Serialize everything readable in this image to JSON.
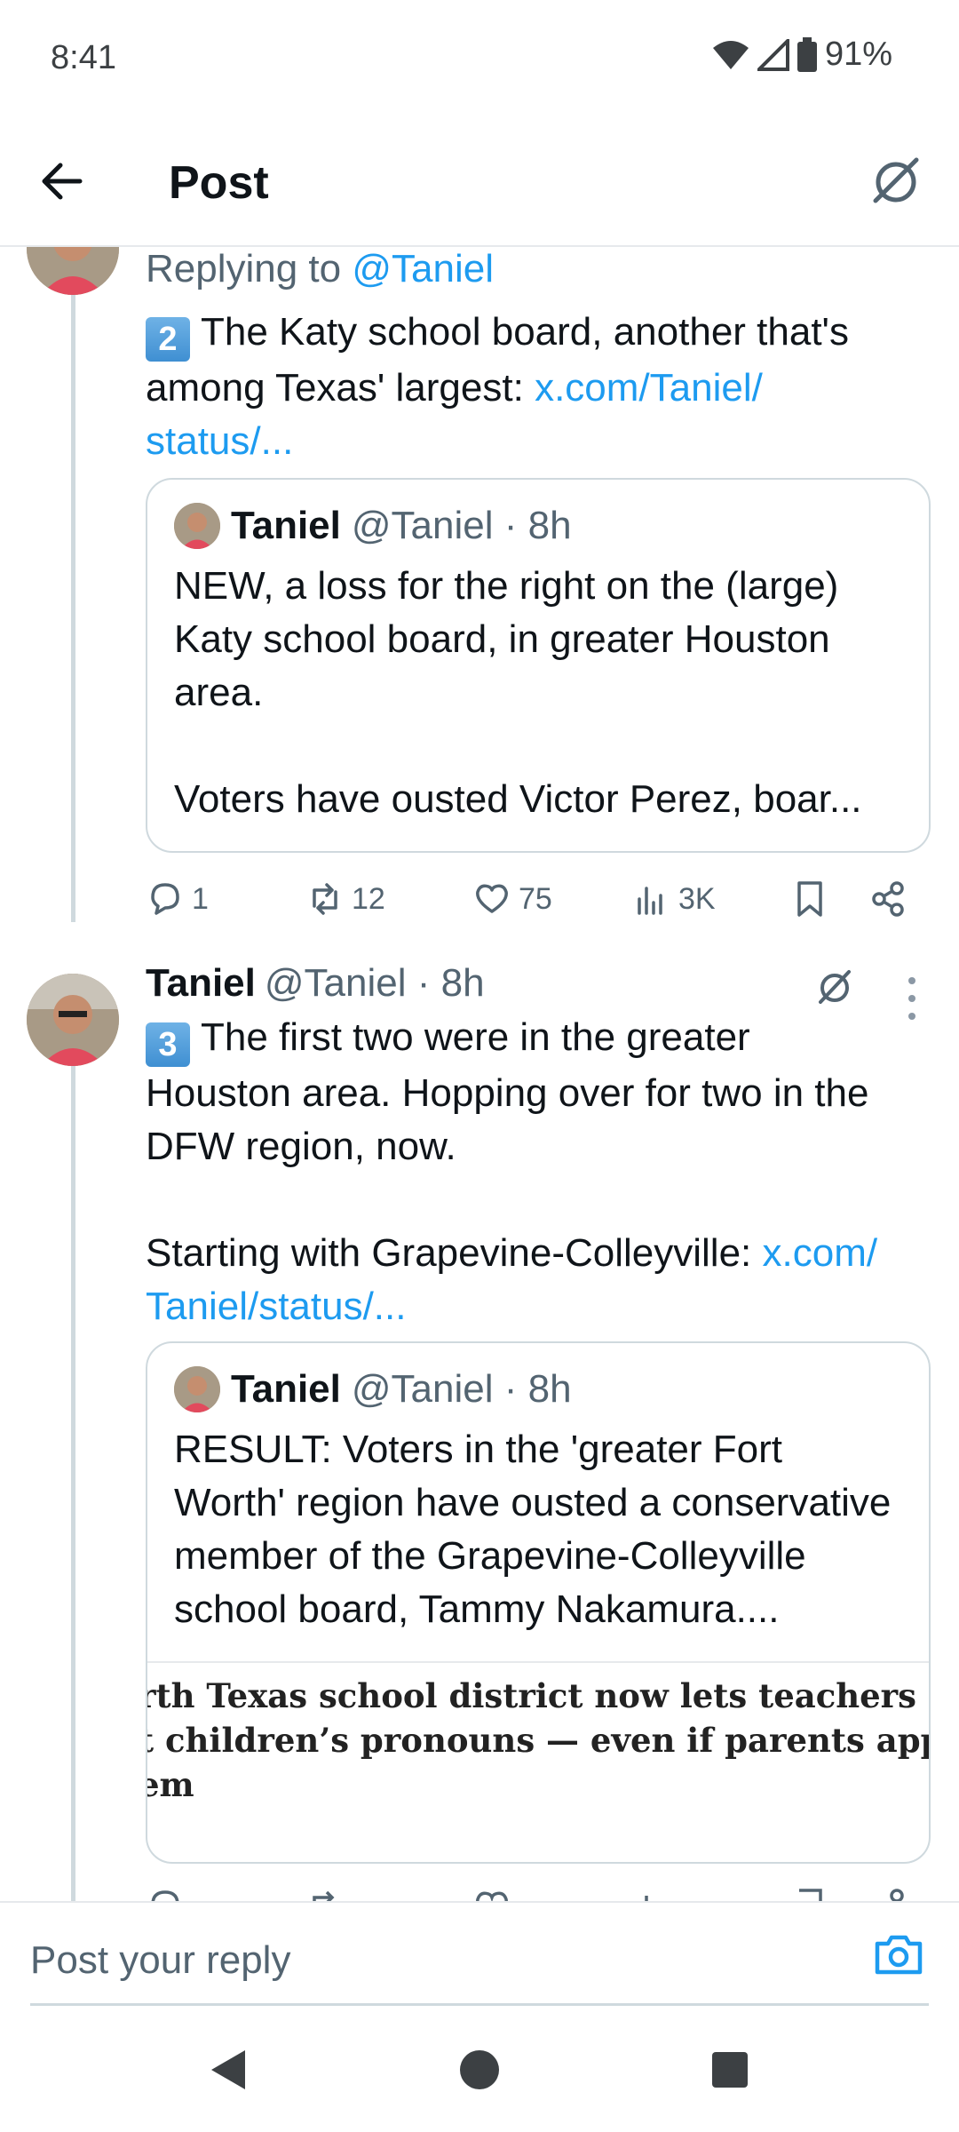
{
  "status_bar": {
    "time": "8:41",
    "battery": "91%"
  },
  "header": {
    "title": "Post"
  },
  "thread": {
    "replying_prefix": "Replying to",
    "replying_handle": "@Taniel",
    "post2": {
      "keycap": "2",
      "text": "The Katy school board, another that's among Texas' largest:",
      "link_line1": "x.com/Taniel/",
      "link_line2": "status/...",
      "quote": {
        "name": "Taniel",
        "handle_time": "@Taniel · 8h",
        "text": "NEW, a loss for the right on the (large) Katy school board, in greater Houston area.\n\nVoters have ousted Victor Perez, boar..."
      },
      "stats": {
        "replies": "1",
        "reposts": "12",
        "likes": "75",
        "views": "3K"
      }
    },
    "post3": {
      "name": "Taniel",
      "handle_time": "@Taniel · 8h",
      "keycap": "3",
      "text_line1": "The first two were in the greater",
      "text_line2": "Houston area. Hopping over for two in the",
      "text_line3": "DFW region, now.",
      "text_line4": "Starting with Grapevine-Colleyville:",
      "link_line1": "x.com/",
      "link_line2": "Taniel/status/...",
      "quote": {
        "name": "Taniel",
        "handle_time": "@Taniel · 8h",
        "text": "RESULT: Voters in the 'greater Fort Worth' region have ousted a conservative member of the Grapevine-Colleyville school board, Tammy Nakamura....",
        "article_line1": "rth Texas school district now lets teachers",
        "article_line2": "t children’s pronouns — even if parents appro",
        "article_line3": "em"
      }
    }
  },
  "reply_bar": {
    "placeholder": "Post your reply"
  },
  "icons": [
    "back-arrow-icon",
    "grok-icon",
    "reply-icon",
    "repost-icon",
    "like-icon",
    "views-icon",
    "bookmark-icon",
    "share-icon",
    "more-icon",
    "camera-icon",
    "wifi-icon",
    "signal-icon",
    "battery-icon"
  ],
  "colors": {
    "link": "#1d9bf0",
    "muted": "#536471",
    "thread_line": "#cfd9de"
  }
}
